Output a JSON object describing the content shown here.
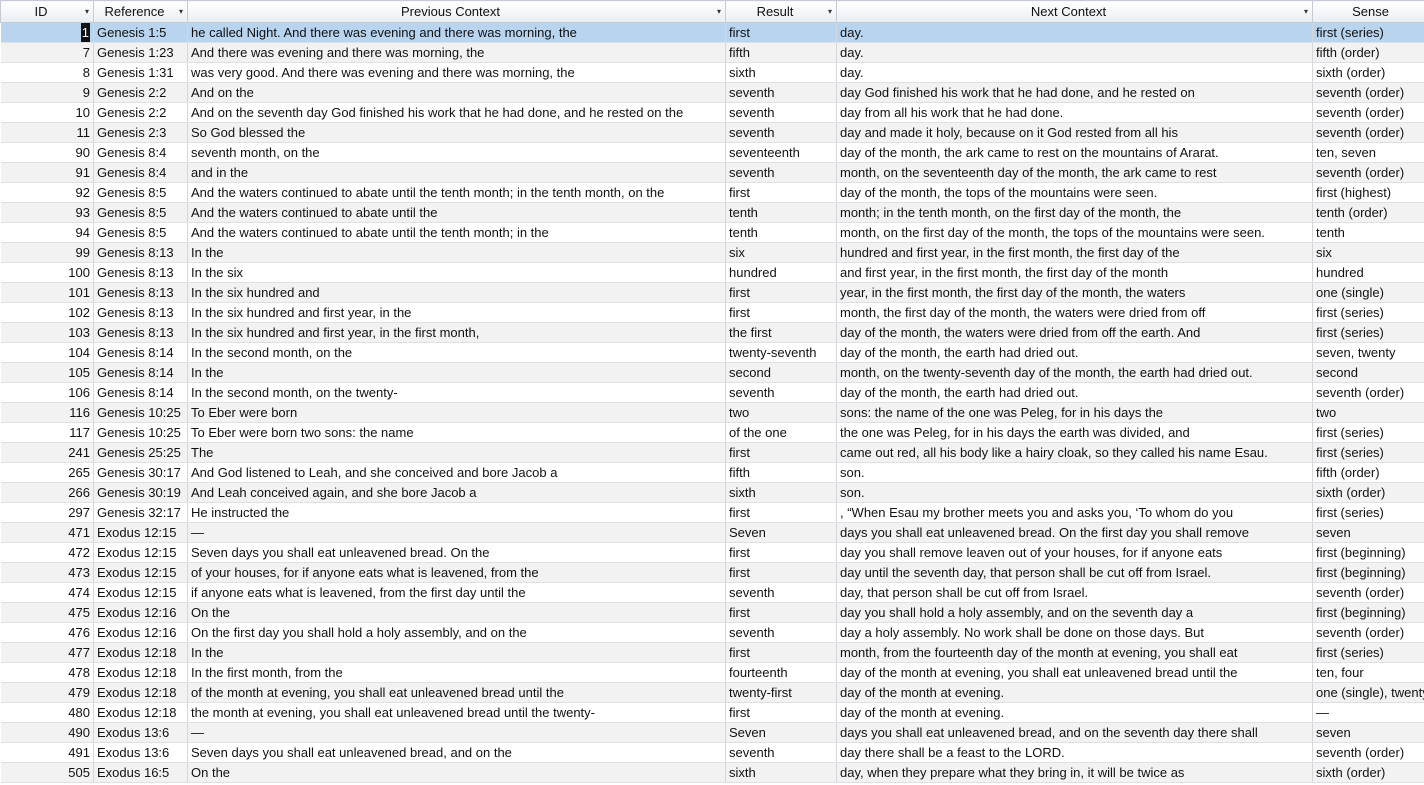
{
  "columns": [
    {
      "label": "ID",
      "dropdown": true
    },
    {
      "label": "Reference",
      "dropdown": true
    },
    {
      "label": "Previous Context",
      "dropdown": true
    },
    {
      "label": "Result",
      "dropdown": true
    },
    {
      "label": "Next Context",
      "dropdown": true
    },
    {
      "label": "Sense",
      "dropdown": true
    }
  ],
  "selected_row_index": 0,
  "colors": {
    "selected_row": "#b9d4ef",
    "alt_row": "#f2f2f2"
  },
  "rows": [
    [
      "1",
      "Genesis 1:5",
      "he called Night. And there was evening and there was morning, the",
      "first",
      "day.",
      "first (series)"
    ],
    [
      "7",
      "Genesis 1:23",
      "And there was evening and there was morning, the",
      "fifth",
      "day.",
      "fifth (order)"
    ],
    [
      "8",
      "Genesis 1:31",
      "was very good. And there was evening and there was morning, the",
      "sixth",
      "day.",
      "sixth (order)"
    ],
    [
      "9",
      "Genesis 2:2",
      "And on the",
      "seventh",
      "day God finished his work that he had done, and he rested on",
      "seventh (order)"
    ],
    [
      "10",
      "Genesis 2:2",
      "And on the seventh day God finished his work that he had done, and he rested on the",
      "seventh",
      "day from all his work that he had done.",
      "seventh (order)"
    ],
    [
      "11",
      "Genesis 2:3",
      "So God blessed the",
      "seventh",
      "day and made it holy, because on it God rested from all his",
      "seventh (order)"
    ],
    [
      "90",
      "Genesis 8:4",
      "seventh month, on the",
      "seventeenth",
      "day of the month, the ark came to rest on the mountains of Ararat.",
      "ten, seven"
    ],
    [
      "91",
      "Genesis 8:4",
      "and in the",
      "seventh",
      "month, on the seventeenth day of the month, the ark came to rest",
      "seventh (order)"
    ],
    [
      "92",
      "Genesis 8:5",
      "And the waters continued to abate until the tenth month; in the tenth month, on the",
      "first",
      "day of the month, the tops of the mountains were seen.",
      "first (highest)"
    ],
    [
      "93",
      "Genesis 8:5",
      "And the waters continued to abate until the",
      "tenth",
      "month; in the tenth month, on the first day of the month, the",
      "tenth (order)"
    ],
    [
      "94",
      "Genesis 8:5",
      "And the waters continued to abate until the tenth month; in the",
      "tenth",
      "month, on the first day of the month, the tops of the mountains were seen.",
      "tenth"
    ],
    [
      "99",
      "Genesis 8:13",
      "In the",
      "six",
      "hundred and first year, in the first month, the first day of the",
      "six"
    ],
    [
      "100",
      "Genesis 8:13",
      "In the six",
      "hundred",
      "and first year, in the first month, the first day of the month",
      "hundred"
    ],
    [
      "101",
      "Genesis 8:13",
      "In the six hundred and",
      "first",
      "year, in the first month, the first day of the month, the waters",
      "one (single)"
    ],
    [
      "102",
      "Genesis 8:13",
      "In the six hundred and first year, in the",
      "first",
      "month, the first day of the month, the waters were dried from off",
      "first (series)"
    ],
    [
      "103",
      "Genesis 8:13",
      "In the six hundred and first year, in the first month,",
      "the first",
      "day of the month, the waters were dried from off the earth. And",
      "first (series)"
    ],
    [
      "104",
      "Genesis 8:14",
      "In the second month, on the",
      "twenty-seventh",
      "day of the month, the earth had dried out.",
      "seven, twenty"
    ],
    [
      "105",
      "Genesis 8:14",
      "In the",
      "second",
      "month, on the twenty-seventh day of the month, the earth had dried out.",
      "second"
    ],
    [
      "106",
      "Genesis 8:14",
      "In the second month, on the twenty-",
      "seventh",
      "day of the month, the earth had dried out.",
      "seventh (order)"
    ],
    [
      "116",
      "Genesis 10:25",
      "To Eber were born",
      "two",
      "sons: the name of the one was Peleg, for in his days the",
      "two"
    ],
    [
      "117",
      "Genesis 10:25",
      "To Eber were born two sons: the name",
      "of the one",
      "the one was Peleg, for in his days the earth was divided, and",
      "first (series)"
    ],
    [
      "241",
      "Genesis 25:25",
      "The",
      "first",
      "came out red, all his body like a hairy cloak, so they called his name Esau.",
      "first (series)"
    ],
    [
      "265",
      "Genesis 30:17",
      "And God listened to Leah, and she conceived and bore Jacob a",
      "fifth",
      "son.",
      "fifth (order)"
    ],
    [
      "266",
      "Genesis 30:19",
      "And Leah conceived again, and she bore Jacob a",
      "sixth",
      "son.",
      "sixth (order)"
    ],
    [
      "297",
      "Genesis 32:17",
      "He instructed the",
      "first",
      ", “When Esau my brother meets you and asks you, ‘To whom do you",
      "first (series)"
    ],
    [
      "471",
      "Exodus 12:15",
      "—",
      "Seven",
      "days you shall eat unleavened bread. On the first day you shall remove",
      "seven"
    ],
    [
      "472",
      "Exodus 12:15",
      "Seven days you shall eat unleavened bread. On the",
      "first",
      "day you shall remove leaven out of your houses, for if anyone eats",
      "first (beginning)"
    ],
    [
      "473",
      "Exodus 12:15",
      "of your houses, for if anyone eats what is leavened, from the",
      "first",
      "day until the seventh day, that person shall be cut off from Israel.",
      "first (beginning)"
    ],
    [
      "474",
      "Exodus 12:15",
      "if anyone eats what is leavened, from the first day until the",
      "seventh",
      "day, that person shall be cut off from Israel.",
      "seventh (order)"
    ],
    [
      "475",
      "Exodus 12:16",
      "On the",
      "first",
      "day you shall hold a holy assembly, and on the seventh day a",
      "first (beginning)"
    ],
    [
      "476",
      "Exodus 12:16",
      "On the first day you shall hold a holy assembly, and on the",
      "seventh",
      "day a holy assembly. No work shall be done on those days. But",
      "seventh (order)"
    ],
    [
      "477",
      "Exodus 12:18",
      "In the",
      "first",
      "month, from the fourteenth day of the month at evening, you shall eat",
      "first (series)"
    ],
    [
      "478",
      "Exodus 12:18",
      "In the first month, from the",
      "fourteenth",
      "day of the month at evening, you shall eat unleavened bread until the",
      "ten, four"
    ],
    [
      "479",
      "Exodus 12:18",
      "of the month at evening, you shall eat unleavened bread until the",
      "twenty-first",
      "day of the month at evening.",
      "one (single), twenty"
    ],
    [
      "480",
      "Exodus 12:18",
      "the month at evening, you shall eat unleavened bread until the twenty-",
      "first",
      "day of the month at evening.",
      "—"
    ],
    [
      "490",
      "Exodus 13:6",
      "—",
      "Seven",
      "days you shall eat unleavened bread, and on the seventh day there shall",
      "seven"
    ],
    [
      "491",
      "Exodus 13:6",
      "Seven days you shall eat unleavened bread, and on the",
      "seventh",
      "day there shall be a feast to the LORD.",
      "seventh (order)"
    ],
    [
      "505",
      "Exodus 16:5",
      "On the",
      "sixth",
      "day, when they prepare what they bring in, it will be twice as",
      "sixth (order)"
    ]
  ]
}
